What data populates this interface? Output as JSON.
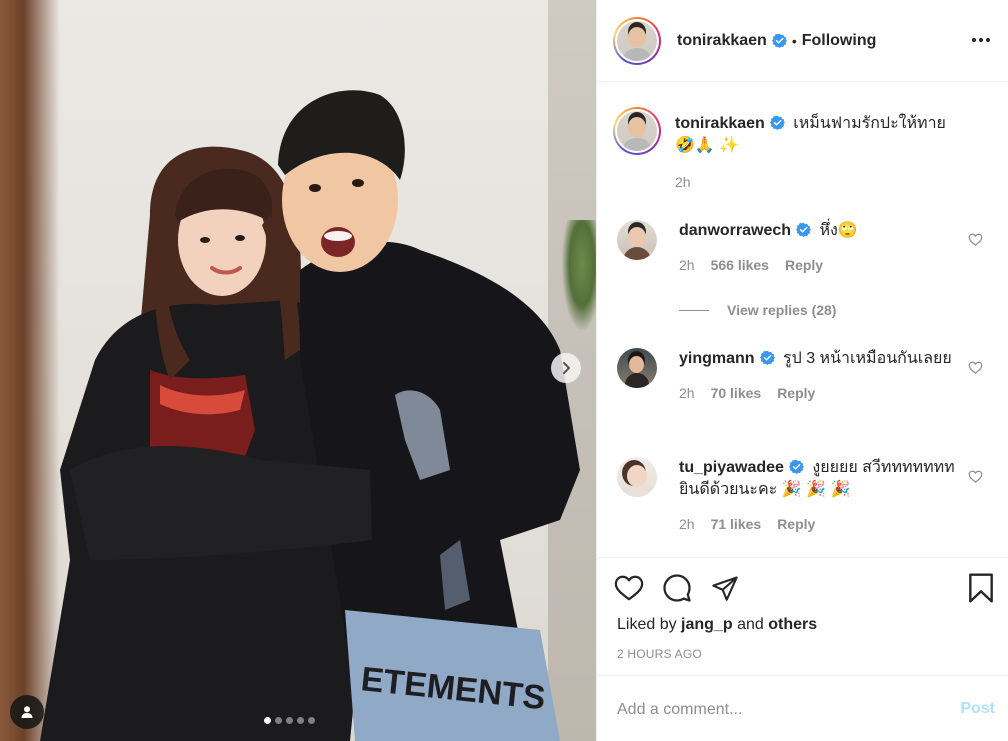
{
  "header": {
    "username": "tonirakkaen",
    "separator": "•",
    "follow_status": "Following"
  },
  "caption": {
    "username": "tonirakkaen",
    "text": "เหม็นฟามรักปะให้ทาย",
    "emojis": "🤣🙏 ✨",
    "time": "2h"
  },
  "comments": [
    {
      "username": "danworrawech",
      "text": "หึ่ง🙄",
      "time": "2h",
      "likes": "566 likes",
      "reply": "Reply",
      "view_replies": "View replies (28)"
    },
    {
      "username": "yingmann",
      "text": "รูป 3 หน้าเหมือนกันเลยย",
      "time": "2h",
      "likes": "70 likes",
      "reply": "Reply"
    },
    {
      "username": "tu_piyawadee",
      "text": "งูยยยย สวีททททททท ยินดีด้วยนะคะ 🎉 🎉 🎉",
      "time": "2h",
      "likes": "71 likes",
      "reply": "Reply"
    }
  ],
  "likes": {
    "prefix": "Liked by",
    "user": "jang_p",
    "conj": "and",
    "others": "others"
  },
  "timestamp": "2 HOURS AGO",
  "add_comment": {
    "placeholder": "Add a comment...",
    "post_label": "Post"
  },
  "carousel": {
    "slide_count": 5,
    "active_slide": 1
  },
  "colors": {
    "verified": "#3897f0",
    "post_disabled": "#b2dffc",
    "muted": "#8e8e8e"
  },
  "icons": [
    "verified-badge-icon",
    "more-options-icon",
    "heart-icon",
    "comment-icon",
    "share-icon",
    "bookmark-icon",
    "chevron-right-icon",
    "user-tag-icon"
  ]
}
